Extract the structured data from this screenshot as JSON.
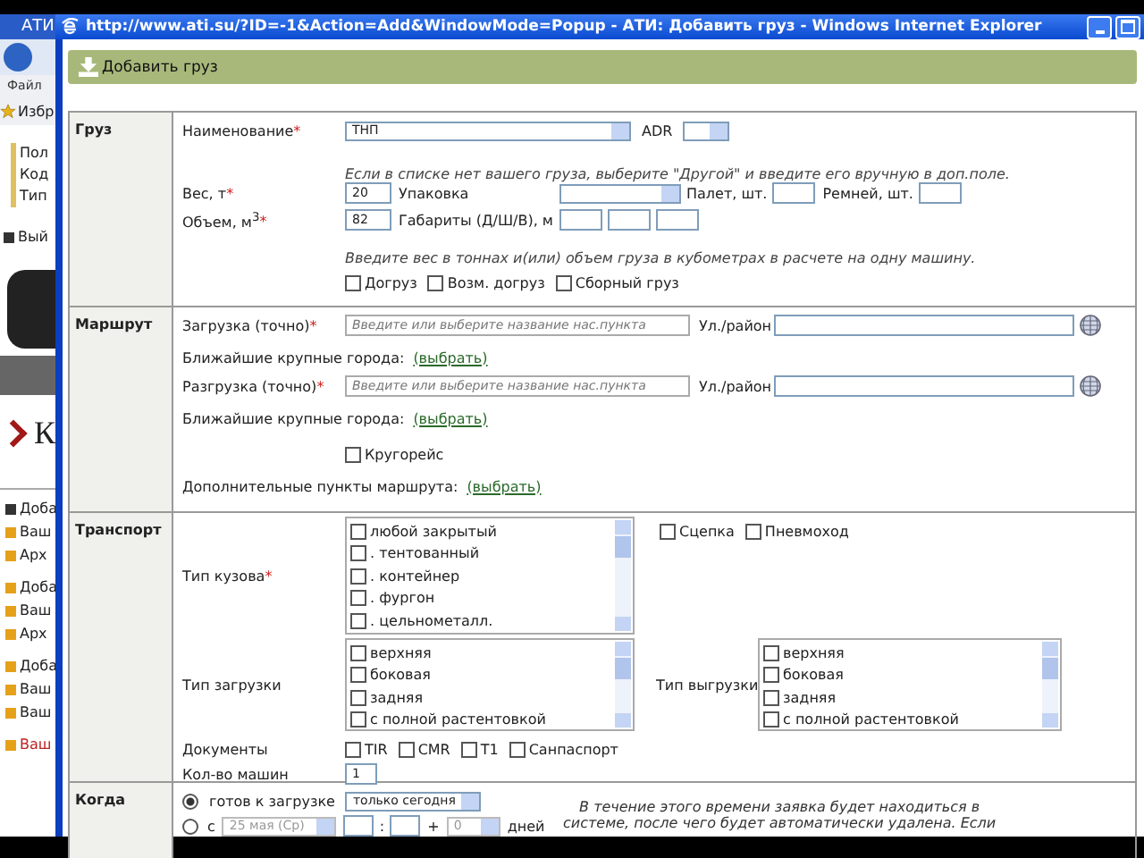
{
  "background_window": {
    "title_fragment": "АТИ",
    "menu_item": "Файл",
    "favorites": "Избр",
    "fields": [
      "Пол",
      "Код",
      "Тип"
    ],
    "exit": "Вый",
    "heading_fragment": "К",
    "links": [
      {
        "label": "Доба",
        "highlight": false
      },
      {
        "label": "Ваш",
        "highlight": false
      },
      {
        "label": "Арх",
        "highlight": false
      },
      {
        "label": "Доба",
        "highlight": false
      },
      {
        "label": "Ваш",
        "highlight": false
      },
      {
        "label": "Арх",
        "highlight": false
      },
      {
        "label": "Доба",
        "highlight": false
      },
      {
        "label": "Ваш",
        "highlight": false
      },
      {
        "label": "Ваш",
        "highlight": false
      },
      {
        "label": "Ваш",
        "highlight": true
      }
    ]
  },
  "popup": {
    "title": "http://www.ati.su/?ID=-1&Action=Add&WindowMode=Popup - АТИ: Добавить груз - Windows Internet Explorer",
    "header": "Добавить груз",
    "cargo": {
      "section": "Груз",
      "name_label": {
        "text": "Наименование",
        "mark": "*"
      },
      "name_value": "ТНП",
      "adr_label": "ADR",
      "hint": "Если в списке нет вашего груза, выберите \"Другой\" и введите его вручную в доп.поле.",
      "weight_label": {
        "text": "Вес, т",
        "mark": "*"
      },
      "weight": "20",
      "packaging_label": "Упаковка",
      "pallets_label": "Палет, шт.",
      "belts_label": "Ремней, шт.",
      "volume_label": {
        "text": "Объем, м$^{3}$",
        "mark": "*"
      },
      "volume": "82",
      "dims_label": "Габариты (Д/Ш/В), м",
      "hint2": "Введите вес в тоннах и(или) объем груза в кубометрах в расчете на одну машину.",
      "options": [
        {
          "label": "Догруз",
          "checked": false
        },
        {
          "label": "Возм. догруз",
          "checked": false
        },
        {
          "label": "Сборный груз",
          "checked": false
        }
      ]
    },
    "route": {
      "section": "Маршрут",
      "points": [
        {
          "label": {
            "text": "Загрузка (точно)",
            "mark": "*"
          },
          "placeholder": "Введите или выберите название нас.пункта",
          "street_label": "Ул./район",
          "nearby_label": "Ближайшие крупные города:",
          "nearby_link": "(выбрать)"
        },
        {
          "label": {
            "text": "Разгрузка (точно)",
            "mark": "*"
          },
          "placeholder": "Введите или выберите название нас.пункта",
          "street_label": "Ул./район",
          "nearby_label": "Ближайшие крупные города:",
          "nearby_link": "(выбрать)"
        }
      ],
      "roundtrip": {
        "label": "Кругорейс",
        "checked": false
      },
      "extra_label": "Дополнительные пункты маршрута:",
      "extra_link": "(выбрать)"
    },
    "transport": {
      "section": "Транспорт",
      "body_label": {
        "text": "Тип кузова",
        "mark": "*"
      },
      "body_types": [
        {
          "label": "любой закрытый",
          "checked": false
        },
        {
          "label": ". тентованный",
          "checked": false
        },
        {
          "label": ". контейнер",
          "checked": false
        },
        {
          "label": ". фургон",
          "checked": false
        },
        {
          "label": ". цельнометалл.",
          "checked": false
        }
      ],
      "extras": [
        {
          "label": "Сцепка",
          "checked": false
        },
        {
          "label": "Пневмоход",
          "checked": false
        }
      ],
      "loading_label": "Тип загрузки",
      "loading_types": [
        {
          "label": "верхняя",
          "checked": false
        },
        {
          "label": "боковая",
          "checked": false
        },
        {
          "label": "задняя",
          "checked": false
        },
        {
          "label": "с полной растентовкой",
          "checked": false
        }
      ],
      "unloading_label": "Тип выгрузки",
      "unloading_types": [
        {
          "label": "верхняя",
          "checked": false
        },
        {
          "label": "боковая",
          "checked": false
        },
        {
          "label": "задняя",
          "checked": false
        },
        {
          "label": "с полной растентовкой",
          "checked": false
        }
      ],
      "documents_label": "Документы",
      "documents": [
        {
          "label": "TIR",
          "checked": false
        },
        {
          "label": "CMR",
          "checked": false
        },
        {
          "label": "T1",
          "checked": false
        },
        {
          "label": "Санпаспорт",
          "checked": false
        }
      ],
      "count_label": "Кол-во машин",
      "count": "1"
    },
    "when": {
      "section": "Когда",
      "ready": {
        "selected": true,
        "label": "готов к загрузке",
        "period": "только сегодня"
      },
      "from": {
        "selected": false,
        "label": "с",
        "date": "25 мая (Ср)",
        "colon": ":",
        "plus": "+",
        "days": "0"
      },
      "days_label": "дней",
      "note": [
        "В течение этого времени заявка будет находиться в",
        "системе, после чего будет автоматически удалена. Если"
      ]
    }
  }
}
